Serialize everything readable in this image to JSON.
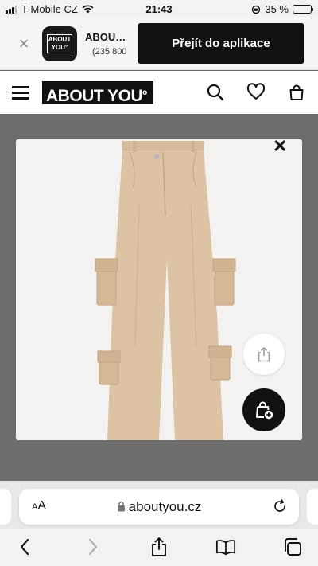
{
  "status_bar": {
    "carrier": "T-Mobile CZ",
    "time": "21:43",
    "battery_percent": "35 %",
    "battery_level": 0.35
  },
  "app_banner": {
    "app_icon_text_line1": "ABOUT",
    "app_icon_text_line2": "YOU°",
    "app_name": "ABOU…",
    "app_meta": "(235 800",
    "open_button_label": "Přejít do aplikace"
  },
  "site_header": {
    "logo_text": "ABOUT YOU",
    "logo_mark": "o",
    "icons": [
      "menu-icon",
      "search-icon",
      "heart-icon",
      "shopping-bag-icon"
    ]
  },
  "modal": {
    "close_glyph": "✕",
    "image_subject": "beige cargo pants",
    "buttons": [
      "share-icon",
      "add-to-bag-icon"
    ]
  },
  "browser": {
    "aa_label_small": "A",
    "aa_label_large": "A",
    "url": "aboutyou.cz",
    "toolbar_icons": [
      "back-icon",
      "forward-icon",
      "share-icon",
      "bookmarks-icon",
      "tabs-icon"
    ]
  },
  "colors": {
    "brand_black": "#111111",
    "overlay": "#6d6d6d",
    "pants": "#dcc3a3"
  }
}
